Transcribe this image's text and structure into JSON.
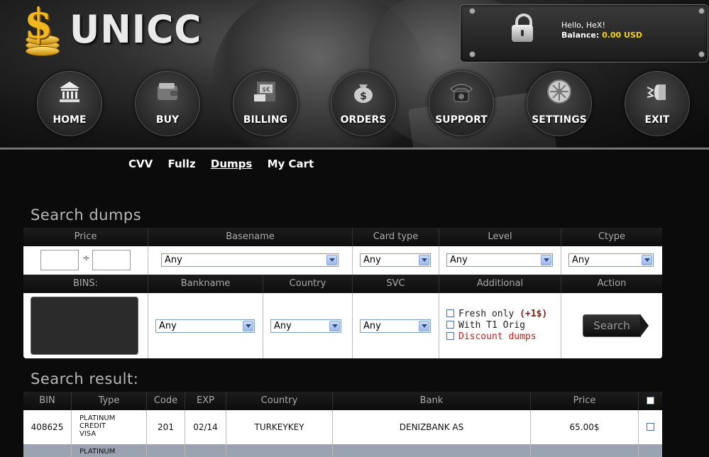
{
  "brand": {
    "name": "UNICC",
    "logo_icon": "dollar-coins-icon"
  },
  "user": {
    "greeting": "Hello, HeX!",
    "balance_label": "Balance:",
    "balance_value": "0.00 USD"
  },
  "nav": [
    {
      "label": "HOME",
      "icon": "bank-icon"
    },
    {
      "label": "BUY",
      "icon": "wallet-icon"
    },
    {
      "label": "BILLING",
      "icon": "atm-icon"
    },
    {
      "label": "ORDERS",
      "icon": "money-bag-icon"
    },
    {
      "label": "SUPPORT",
      "icon": "telephone-icon"
    },
    {
      "label": "SETTINGS",
      "icon": "vault-dial-icon"
    },
    {
      "label": "EXIT",
      "icon": "bullet-icon"
    }
  ],
  "subnav": [
    "CVV",
    "Fullz",
    "Dumps",
    "My Cart"
  ],
  "search": {
    "title": "Search dumps",
    "headers_top": [
      "Price",
      "Basename",
      "Card type",
      "Level",
      "Ctype"
    ],
    "price_sep": "÷",
    "basename": "Any",
    "card_type": "Any",
    "level": "Any",
    "ctype": "Any",
    "headers_bottom": [
      "BINS:",
      "Bankname",
      "Country",
      "SVC",
      "Additional",
      "Action"
    ],
    "bankname": "Any",
    "country": "Any",
    "svc": "Any",
    "additional": {
      "fresh": "Fresh only",
      "fresh_extra": "(+1$)",
      "t1": "With T1 Orig",
      "discount": "Discount dumps"
    },
    "action_button": "Search"
  },
  "results": {
    "title": "Search result:",
    "headers": [
      "BIN",
      "Type",
      "Code",
      "EXP",
      "Country",
      "Bank",
      "Price"
    ],
    "rows": [
      {
        "bin": "408625",
        "type": [
          "PLATINUM",
          "CREDIT",
          "VISA"
        ],
        "code": "201",
        "exp": "02/14",
        "country": "TURKEYKEY",
        "bank": "DENIZBANK AS",
        "price": "65.00$"
      },
      {
        "bin": "",
        "type": [
          "PLATINUM"
        ],
        "code": "",
        "exp": "",
        "country": "",
        "bank": "",
        "price": ""
      }
    ]
  }
}
